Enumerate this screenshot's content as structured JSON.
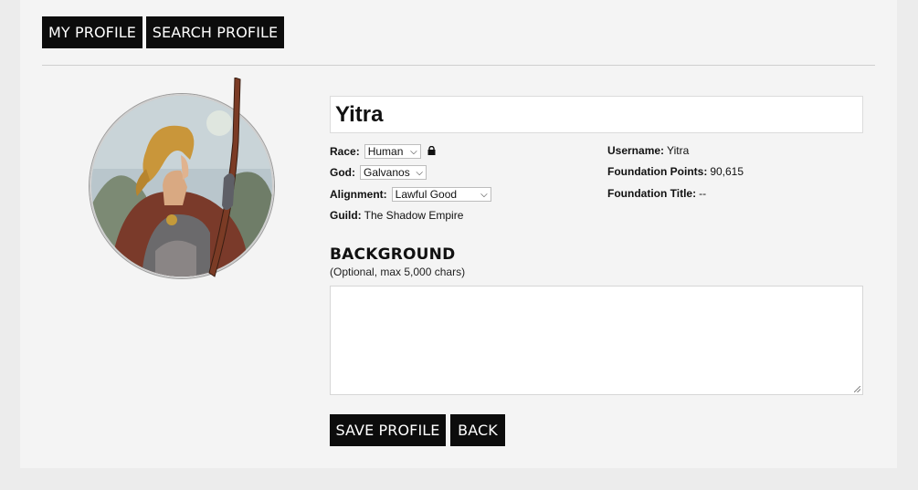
{
  "nav": {
    "my_profile": "MY PROFILE",
    "search_profile": "SEARCH PROFILE"
  },
  "profile": {
    "name": "Yitra",
    "race_label": "Race:",
    "race_value": "Human",
    "god_label": "God:",
    "god_value": "Galvanos",
    "alignment_label": "Alignment:",
    "alignment_value": "Lawful Good",
    "guild_label": "Guild:",
    "guild_value": "The Shadow Empire",
    "username_label": "Username:",
    "username_value": "Yitra",
    "foundation_points_label": "Foundation Points:",
    "foundation_points_value": "90,615",
    "foundation_title_label": "Foundation Title:",
    "foundation_title_value": "--"
  },
  "background": {
    "title": "BACKGROUND",
    "subtitle": "(Optional, max 5,000 chars)",
    "value": ""
  },
  "actions": {
    "save": "SAVE PROFILE",
    "back": "BACK"
  },
  "icons": {
    "race_lock": "lock-icon",
    "dropdown": "chevron-down-icon"
  }
}
